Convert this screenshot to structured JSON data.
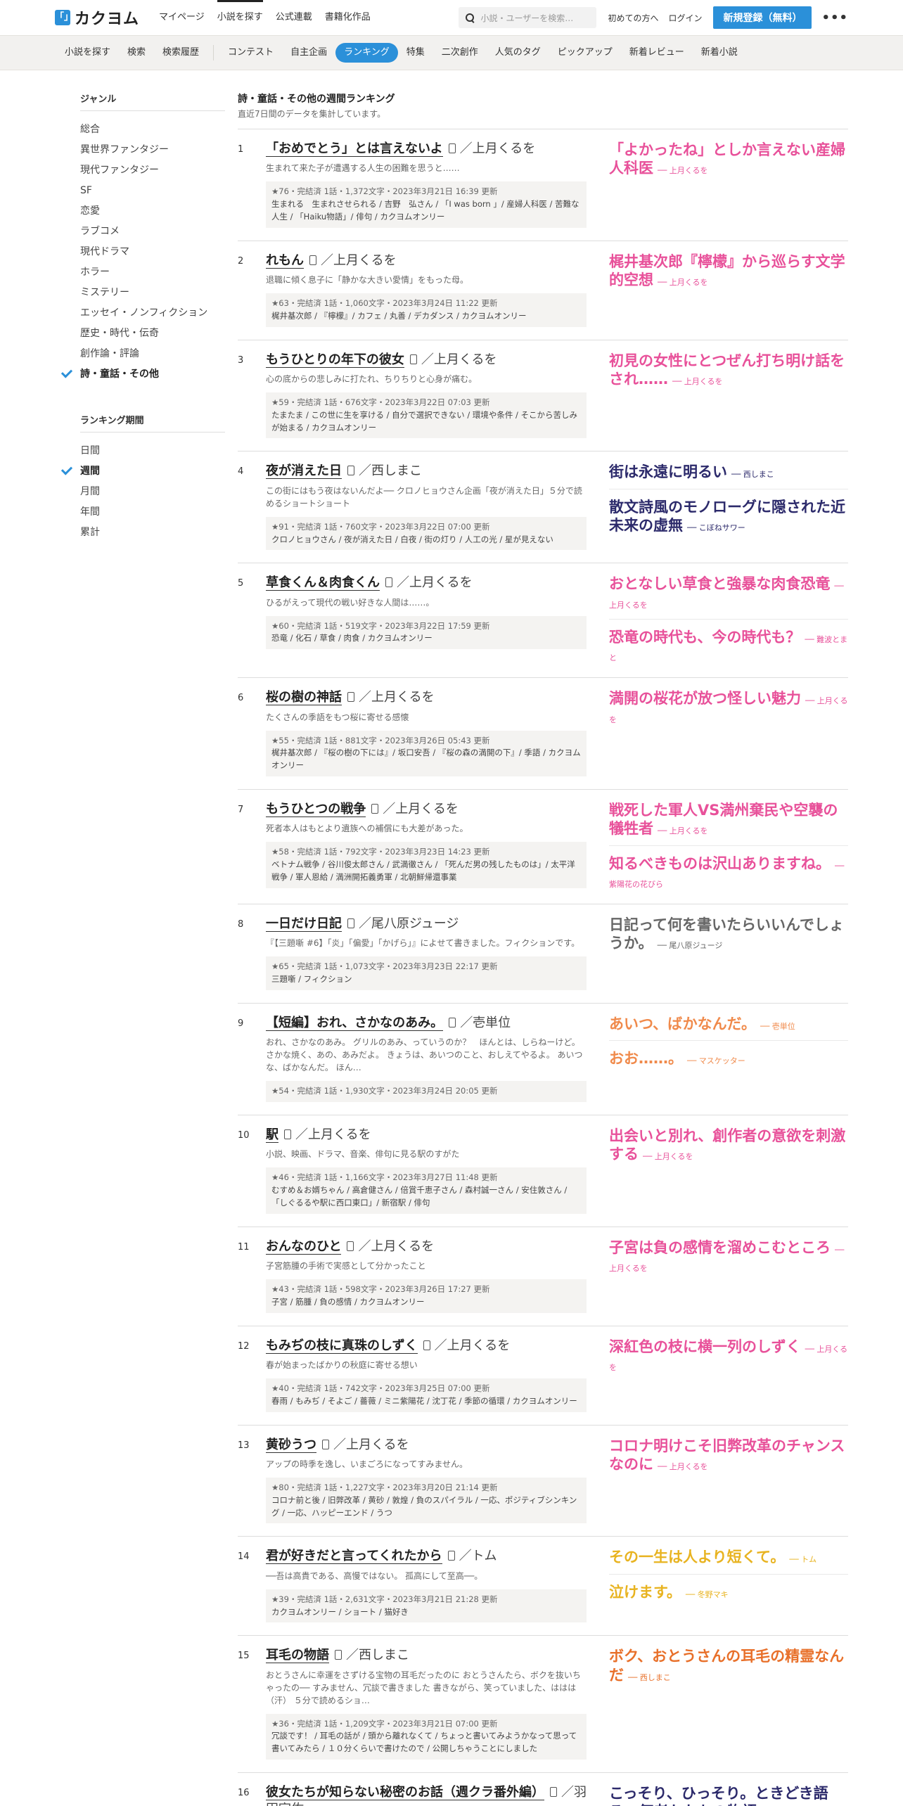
{
  "header": {
    "logo_mark": "「」",
    "logo_text": "カクヨム",
    "nav": [
      "マイページ",
      "小説を探す",
      "公式連載",
      "書籍化作品"
    ],
    "nav_active": 1,
    "search_placeholder": "小説・ユーザーを検索…",
    "links": [
      "初めての方へ",
      "ログイン"
    ],
    "signup": "新規登録（無料）",
    "more": "•••"
  },
  "subnav": {
    "items": [
      "小説を探す",
      "検索",
      "検索履歴",
      "コンテスト",
      "自主企画",
      "ランキング",
      "特集",
      "二次創作",
      "人気のタグ",
      "ピックアップ",
      "新着レビュー",
      "新着小説"
    ],
    "active": 5
  },
  "sidebar": {
    "genre_heading": "ジャンル",
    "genres": [
      "総合",
      "異世界ファンタジー",
      "現代ファンタジー",
      "SF",
      "恋愛",
      "ラブコメ",
      "現代ドラマ",
      "ホラー",
      "ミステリー",
      "エッセイ・ノンフィクション",
      "歴史・時代・伝奇",
      "創作論・評論",
      "詩・童話・その他"
    ],
    "genre_active": 12,
    "period_heading": "ランキング期間",
    "periods": [
      "日間",
      "週間",
      "月間",
      "年間",
      "累計"
    ],
    "period_active": 1
  },
  "main": {
    "title": "詩・童話・その他の週間ランキング",
    "subtitle": "直近7日間のデータを集計しています。"
  },
  "colors": {
    "accent": "#2b90d9",
    "pink": "#e8519a",
    "navy": "#2c2a6b",
    "gray": "#666666",
    "orange": "#f08a4b",
    "yellow": "#e8b320",
    "darkorange": "#e8702a"
  },
  "rankings": [
    {
      "rank": "1",
      "title": "「おめでとう」とは言えないよ",
      "author": "／上月くるを",
      "catch": "生まれて来た子が遭遇する人生の困難を思うと……",
      "info": "★76・完結済 1話・1,372文字・2023年3月21日 16:39 更新",
      "tags": "生まれる　生まれさせられる / 吉野　弘さん / 「I was born 」/ 産婦人科医 / 苦難な人生 / 「Haiku物語」/ 俳句 / カクヨムオンリー",
      "reviews": [
        {
          "text": "「よかったね」としか言えない産婦人科医",
          "by": "── 上月くるを",
          "color": "#e8519a"
        }
      ]
    },
    {
      "rank": "2",
      "title": "れもん",
      "author": "／上月くるを",
      "catch": "退職に傾く息子に「静かな大きい愛情」をもった母。",
      "info": "★63・完結済 1話・1,060文字・2023年3月24日 11:22 更新",
      "tags": "梶井基次郎 / 『檸檬』/ カフェ / 丸善 / デカダンス / カクヨムオンリー",
      "reviews": [
        {
          "text": "梶井基次郎『檸檬』から巡らす文学的空想",
          "by": "── 上月くるを",
          "color": "#e8519a"
        }
      ]
    },
    {
      "rank": "3",
      "title": "もうひとりの年下の彼女",
      "author": "／上月くるを",
      "catch": "心の底からの悲しみに打たれ、ちりちりと心身が痛む。",
      "info": "★59・完結済 1話・676文字・2023年3月22日 07:03 更新",
      "tags": "たまたま / この世に生を享ける / 自分で選択できない / 環境や条件 / そこから苦しみが始まる / カクヨムオンリー",
      "reviews": [
        {
          "text": "初見の女性にとつぜん打ち明け話をされ……",
          "by": "── 上月くるを",
          "color": "#e8519a"
        }
      ]
    },
    {
      "rank": "4",
      "title": "夜が消えた日",
      "author": "／西しまこ",
      "catch": "この街にはもう夜はないんだよ── クロノヒョウさん企画「夜が消えた日」５分で読めるショートショート",
      "info": "★91・完結済 1話・760文字・2023年3月22日 07:00 更新",
      "tags": "クロノヒョウさん / 夜が消えた日 / 白夜 / 街の灯り / 人工の光 / 星が見えない",
      "reviews": [
        {
          "text": "街は永遠に明るい",
          "by": "── 西しまこ",
          "color": "#2c2a6b"
        },
        {
          "text": "散文詩風のモノローグに隠された近未来の虚無",
          "by": "── こぼねサワー",
          "color": "#2c2a6b"
        }
      ]
    },
    {
      "rank": "5",
      "title": "草食くん＆肉食くん",
      "author": "／上月くるを",
      "catch": "ひるがえって現代の戦い好きな人間は……。",
      "info": "★60・完結済 1話・519文字・2023年3月22日 17:59 更新",
      "tags": "恐竜 / 化石 / 草食 / 肉食 / カクヨムオンリー",
      "reviews": [
        {
          "text": "おとなしい草食と強暴な肉食恐竜",
          "by": "── 上月くるを",
          "color": "#e8519a"
        },
        {
          "text": "恐竜の時代も、今の時代も？",
          "by": "── 難波とまと",
          "color": "#e8519a"
        }
      ]
    },
    {
      "rank": "6",
      "title": "桜の樹の神話",
      "author": "／上月くるを",
      "catch": "たくさんの季語をもつ桜に寄せる感懐",
      "info": "★55・完結済 1話・881文字・2023年3月26日 05:43 更新",
      "tags": "梶井基次郎 / 『桜の樹の下には』/ 坂口安吾 / 『桜の森の満開の下』/ 季語 / カクヨムオンリー",
      "reviews": [
        {
          "text": "満開の桜花が放つ怪しい魅力",
          "by": "── 上月くるを",
          "color": "#e8519a"
        }
      ]
    },
    {
      "rank": "7",
      "title": "もうひとつの戦争",
      "author": "／上月くるを",
      "catch": "死者本人はもとより遺族への補償にも大差があった。",
      "info": "★58・完結済 1話・792文字・2023年3月23日 14:23 更新",
      "tags": "ベトナム戦争 / 谷川俊太郎さん / 武満徹さん / 「死んだ男の残したものは」/ 太平洋戦争 / 軍人恩給 / 満洲開拓義勇軍 / 北朝鮮帰還事業",
      "reviews": [
        {
          "text": "戦死した軍人VS満州棄民や空襲の犠牲者",
          "by": "── 上月くるを",
          "color": "#e8519a"
        },
        {
          "text": "知るべきものは沢山ありますね。",
          "by": "── 紫陽花の花びら",
          "color": "#e8519a"
        }
      ]
    },
    {
      "rank": "8",
      "title": "一日だけ日記",
      "author": "／尾八原ジュージ",
      "catch": "『【三題噺 #6】「炎」「偏愛」「かげら」』によせて書きました。フィクションです。",
      "info": "★65・完結済 1話・1,073文字・2023年3月23日 22:17 更新",
      "tags": "三題噺 / フィクション",
      "reviews": [
        {
          "text": "日記って何を書いたらいいんでしょうか。",
          "by": "── 尾八原ジュージ",
          "color": "#666666"
        }
      ]
    },
    {
      "rank": "9",
      "title": "【短編】おれ、さかなのあみ。",
      "author": "／壱単位",
      "catch": "おれ、さかなのあみ。 グリルのあみ、っていうのか？　ほんとは、しらねーけど。さかな焼く、あの、あみだよ。 きょうは、あいつのこと、おしえてやるよ。 あいつな、ばかなんだ。 ほん…",
      "info": "★54・完結済 1話・1,930文字・2023年3月24日 20:05 更新",
      "tags": "",
      "reviews": [
        {
          "text": "あいつ、ばかなんだ。",
          "by": "── 壱単位",
          "color": "#f08a4b"
        },
        {
          "text": "おお……。",
          "by": "── マスケッター",
          "color": "#f08a4b"
        }
      ]
    },
    {
      "rank": "10",
      "title": "駅",
      "author": "／上月くるを",
      "catch": "小説、映画、ドラマ、音楽、俳句に見る駅のすがた",
      "info": "★46・完結済 1話・1,166文字・2023年3月27日 11:48 更新",
      "tags": "むすめ＆お婿ちゃん / 高倉健さん / 倍賞千恵子さん / 森村誠一さん / 安住敦さん / 「しぐるるや駅に西口東口」/ 新宿駅 / 俳句",
      "reviews": [
        {
          "text": "出会いと別れ、創作者の意欲を刺激する",
          "by": "── 上月くるを",
          "color": "#e8519a"
        }
      ]
    },
    {
      "rank": "11",
      "title": "おんなのひと",
      "author": "／上月くるを",
      "catch": "子宮筋腫の手術で実感として分かったこと",
      "info": "★43・完結済 1話・598文字・2023年3月26日 17:27 更新",
      "tags": "子宮 / 筋腫 / 負の感情 / カクヨムオンリー",
      "reviews": [
        {
          "text": "子宮は負の感情を溜めこむところ",
          "by": "── 上月くるを",
          "color": "#e8519a"
        }
      ]
    },
    {
      "rank": "12",
      "title": "もみぢの枝に真珠のしずく",
      "author": "／上月くるを",
      "catch": "春が始まったばかりの秋庭に寄せる想い",
      "info": "★40・完結済 1話・742文字・2023年3月25日 07:00 更新",
      "tags": "春雨 / もみぢ / そよご / 薔薇 / ミニ紫陽花 / 沈丁花 / 季節の循環 / カクヨムオンリー",
      "reviews": [
        {
          "text": "深紅色の枝に横一列のしずく",
          "by": "── 上月くるを",
          "color": "#e8519a"
        }
      ]
    },
    {
      "rank": "13",
      "title": "黄砂うつ",
      "author": "／上月くるを",
      "catch": "アップの時季を逸し、いまごろになってすみません。",
      "info": "★80・完結済 1話・1,227文字・2023年3月20日 21:14 更新",
      "tags": "コロナ前と後 / 旧弊改革 / 黄砂 / 敦煌 / 負のスパイラル / 一応、ポジティブシンキング / 一応、ハッピーエンド / うつ",
      "reviews": [
        {
          "text": "コロナ明けこそ旧弊改革のチャンスなのに",
          "by": "── 上月くるを",
          "color": "#e8519a"
        }
      ]
    },
    {
      "rank": "14",
      "title": "君が好きだと言ってくれたから",
      "author": "／トム",
      "catch": "──吾は高貴である、高慢ではない。 孤高にして至高──。",
      "info": "★39・完結済 1話・2,631文字・2023年3月21日 21:28 更新",
      "tags": "カクヨムオンリー / ショート / 猫好き",
      "reviews": [
        {
          "text": "その一生は人より短くて。",
          "by": "── トム",
          "color": "#e8b320"
        },
        {
          "text": "泣けます。",
          "by": "── 冬野マキ",
          "color": "#e8b320"
        }
      ]
    },
    {
      "rank": "15",
      "title": "耳毛の物語",
      "author": "／西しまこ",
      "catch": "おとうさんに幸運をさずける宝物の耳毛だったのに おとうさんたら、ボクを抜いちゃったの── すみません、冗談で書きました 書きながら、笑っていました、ははは（汗） ５分で読めるショ…",
      "info": "★36・完結済 1話・1,209文字・2023年3月21日 07:00 更新",
      "tags": "冗談です！ / 耳毛の話が / 頭から離れなくて / ちょっと書いてみようかなって思って書いてみたら / １０分くらいで書けたので / 公開しちゃうことにしました",
      "reviews": [
        {
          "text": "ボク、おとうさんの耳毛の精霊なんだ",
          "by": "── 西しまこ",
          "color": "#e8702a"
        }
      ]
    },
    {
      "rank": "16",
      "title": "彼女たちが知らない秘密のお話（週クラ番外編）",
      "author": "／羽田宇佐",
      "catch": "",
      "info": "",
      "tags": "",
      "reviews": [
        {
          "text": "こっそり、ひっそり。ときどき語る、何者かたちの物語",
          "by": "",
          "color": "#2c2a6b"
        }
      ]
    }
  ]
}
